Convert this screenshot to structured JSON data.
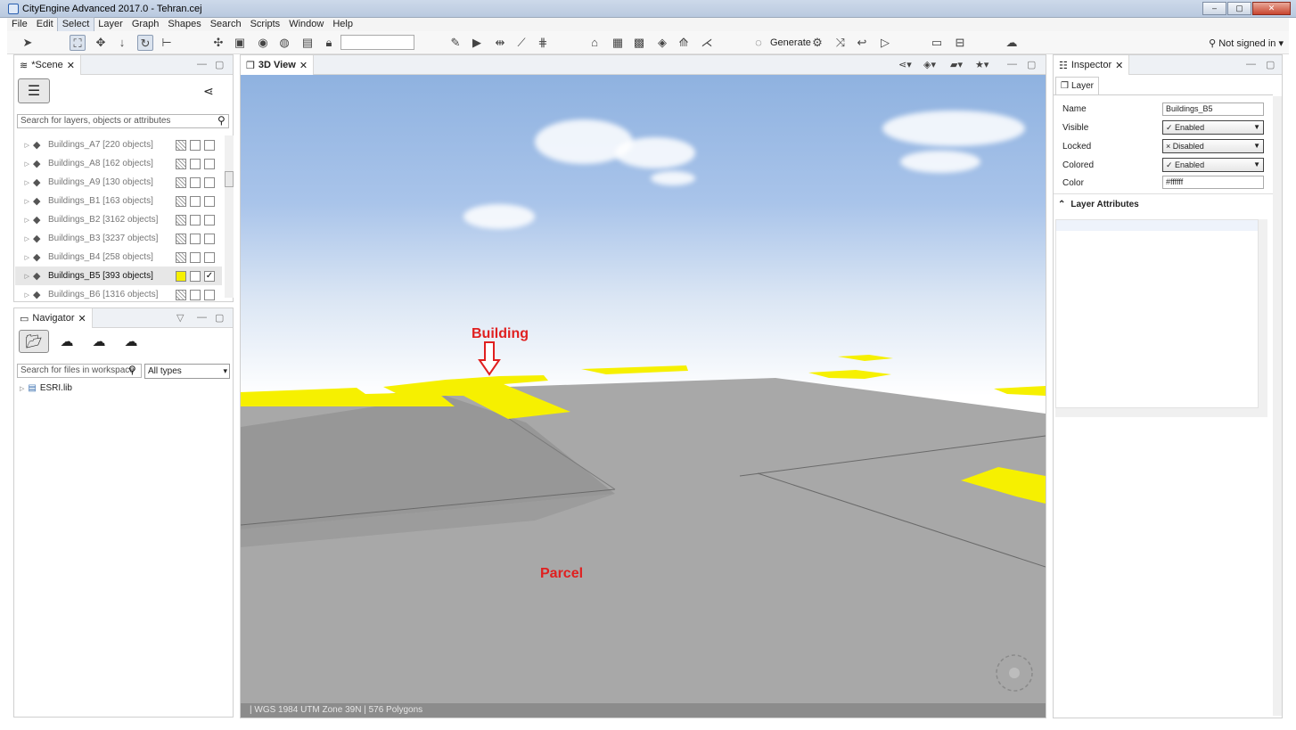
{
  "window": {
    "title": "CityEngine Advanced 2017.0 - Tehran.cej",
    "min": "–",
    "max": "▢",
    "close": "✕"
  },
  "menu": [
    "File",
    "Edit",
    "Select",
    "Layer",
    "Graph",
    "Shapes",
    "Search",
    "Scripts",
    "Window",
    "Help"
  ],
  "toolbar": {
    "generate_label": "Generate",
    "signin_label": "Not signed in",
    "icons": [
      "select-icon",
      "marquee-icon",
      "move-icon",
      "scale-icon",
      "rotate-icon",
      "measure-icon",
      "camera-pan-icon",
      "frame-icon",
      "orbit-icon",
      "globe-icon",
      "bookmark-icon",
      "lock-icon",
      "draw-street-icon",
      "play-icon",
      "align-icon",
      "terrain-icon",
      "grid-icon",
      "building-icon",
      "block-icon",
      "texture-icon",
      "box-icon",
      "tree-icon",
      "road-icon",
      "generate-icon",
      "cga-icon",
      "random-icon",
      "undo-icon",
      "flag-icon",
      "ruler-icon",
      "tool-icon",
      "sun-icon"
    ]
  },
  "scene": {
    "tab_label": "*Scene",
    "search_placeholder": "Search for layers, objects or attributes",
    "layers": [
      {
        "label": "Buildings_A7 [220 objects]",
        "selected": false
      },
      {
        "label": "Buildings_A8 [162 objects]",
        "selected": false
      },
      {
        "label": "Buildings_A9 [130 objects]",
        "selected": false
      },
      {
        "label": "Buildings_B1 [163 objects]",
        "selected": false
      },
      {
        "label": "Buildings_B2 [3162 objects]",
        "selected": false
      },
      {
        "label": "Buildings_B3 [3237 objects]",
        "selected": false
      },
      {
        "label": "Buildings_B4 [258 objects]",
        "selected": false
      },
      {
        "label": "Buildings_B5 [393 objects]",
        "selected": true
      },
      {
        "label": "Buildings_B6 [1316 objects]",
        "selected": false
      }
    ]
  },
  "navigator": {
    "tab_label": "Navigator",
    "search_placeholder": "Search for files in workspace",
    "filter": "All types",
    "tree": [
      {
        "label": "ESRI.lib"
      }
    ]
  },
  "view3d": {
    "tab_label": "3D View",
    "status": "|  WGS 1984 UTM Zone 39N  |  576 Polygons",
    "annotations": {
      "building": "Building",
      "parcel": "Parcel"
    },
    "colors": {
      "building": "#f6f000",
      "parcel": "#a8a8a8",
      "annotation": "#e02020"
    }
  },
  "inspector": {
    "tab_label": "Inspector",
    "subtab_label": "Layer",
    "properties": {
      "name_label": "Name",
      "name_value": "Buildings_B5",
      "visible_label": "Visible",
      "visible_value": "✓ Enabled",
      "locked_label": "Locked",
      "locked_value": "× Disabled",
      "colored_label": "Colored",
      "colored_value": "✓ Enabled",
      "color_label": "Color",
      "color_value": "#ffffff"
    },
    "attributes_header": "Layer Attributes"
  }
}
